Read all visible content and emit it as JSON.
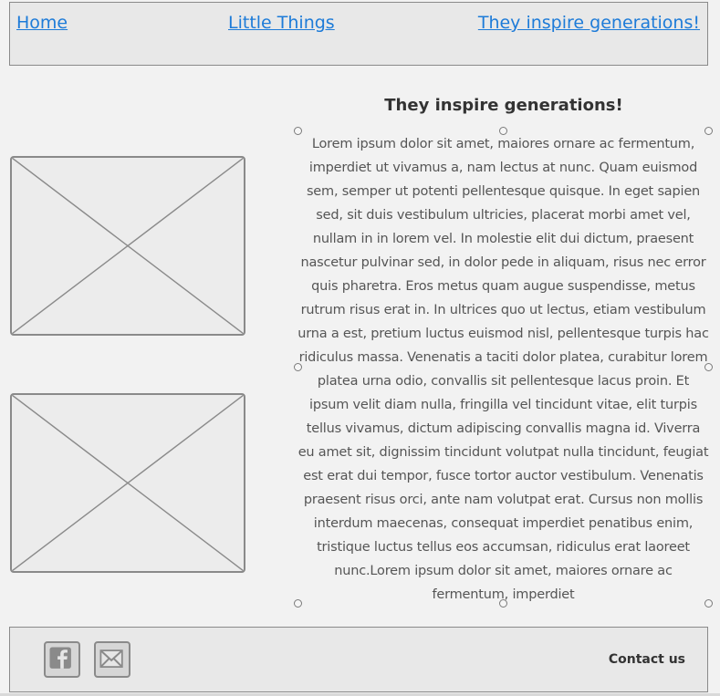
{
  "nav": {
    "home": "Home",
    "little_things": "Little Things",
    "inspire": "They inspire generations!"
  },
  "main": {
    "heading": "They inspire generations!",
    "paragraph": "Lorem ipsum dolor sit amet, maiores ornare ac fermentum, imperdiet ut vivamus a, nam lectus at nunc. Quam euismod sem, semper ut potenti pellentesque quisque. In eget sapien sed, sit duis vestibulum ultricies, placerat morbi amet vel, nullam in in lorem vel. In molestie elit dui dictum, praesent nascetur pulvinar sed, in dolor pede in aliquam, risus nec error quis pharetra. Eros metus quam augue suspendisse, metus rutrum risus erat in.  In ultrices quo ut lectus, etiam vestibulum urna a est, pretium luctus euismod nisl, pellentesque turpis hac ridiculus massa. Venenatis a taciti dolor platea, curabitur lorem platea urna odio, convallis sit pellentesque lacus proin. Et ipsum velit diam nulla, fringilla vel tincidunt vitae, elit turpis tellus vivamus, dictum adipiscing convallis magna id. Viverra eu amet sit, dignissim tincidunt volutpat nulla tincidunt, feugiat est erat dui tempor, fusce tortor auctor vestibulum. Venenatis praesent risus orci, ante nam volutpat erat. Cursus non mollis interdum maecenas, consequat imperdiet penatibus enim, tristique luctus tellus eos accumsan, ridiculus erat laoreet nunc.Lorem ipsum dolor sit amet, maiores ornare ac fermentum, imperdiet"
  },
  "footer": {
    "contact": "Contact us",
    "icons": [
      "facebook-icon",
      "email-icon"
    ]
  },
  "colors": {
    "link": "#1d7bd8",
    "border": "#8a8a8a",
    "panel_bg": "#e8e8e8",
    "page_bg": "#f2f2f2"
  }
}
